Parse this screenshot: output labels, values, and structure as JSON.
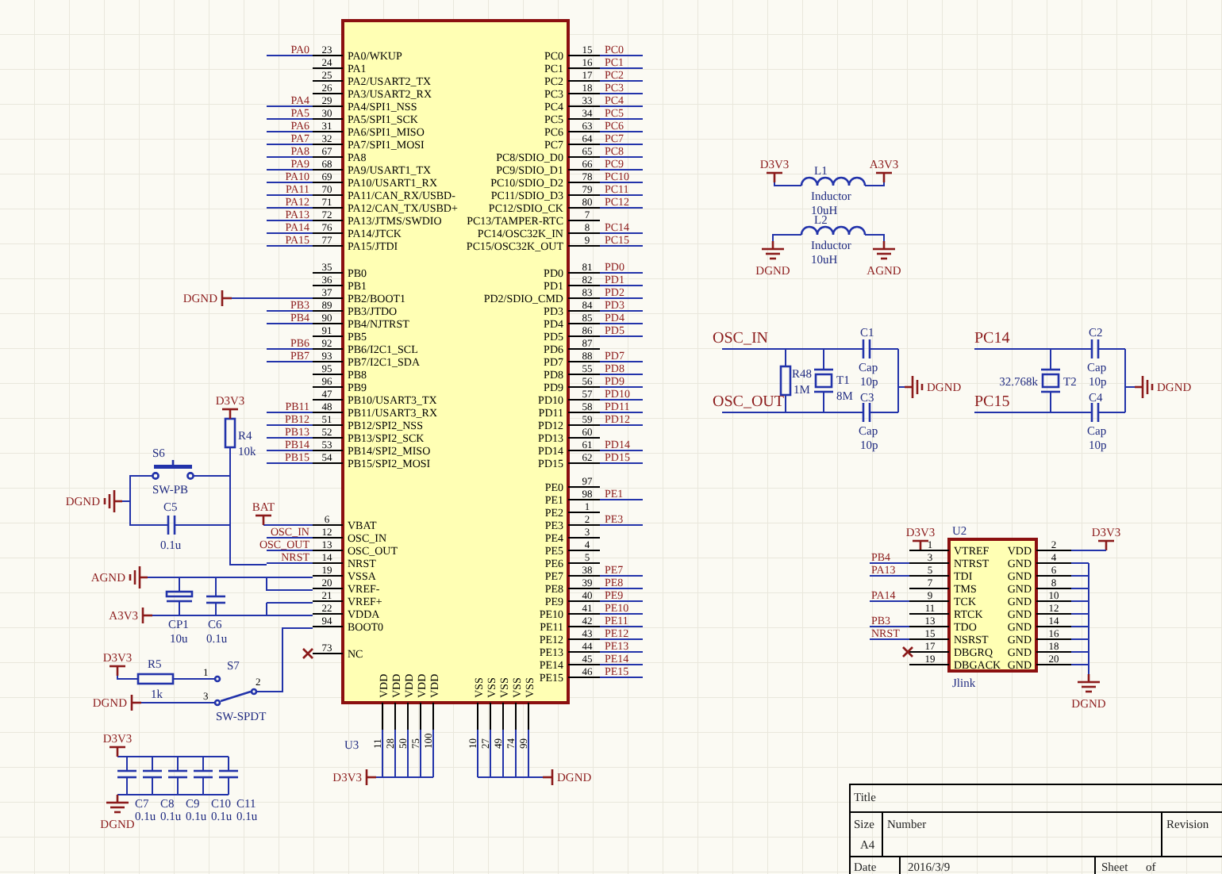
{
  "chip": {
    "designator": "U3",
    "left_pins": [
      {
        "number": "23",
        "name": "PA0/WKUP",
        "net": "PA0",
        "no_connect": false
      },
      {
        "number": "24",
        "name": "PA1",
        "no_connect": false
      },
      {
        "number": "25",
        "name": "PA2/USART2_TX",
        "no_connect": false
      },
      {
        "number": "26",
        "name": "PA3/USART2_RX",
        "no_connect": false
      },
      {
        "number": "29",
        "name": "PA4/SPI1_NSS",
        "net": "PA4",
        "no_connect": false
      },
      {
        "number": "30",
        "name": "PA5/SPI1_SCK",
        "net": "PA5",
        "no_connect": false
      },
      {
        "number": "31",
        "name": "PA6/SPI1_MISO",
        "net": "PA6",
        "no_connect": false
      },
      {
        "number": "32",
        "name": "PA7/SPI1_MOSI",
        "net": "PA7",
        "no_connect": false
      },
      {
        "number": "67",
        "name": "PA8",
        "net": "PA8",
        "no_connect": false
      },
      {
        "number": "68",
        "name": "PA9/USART1_TX",
        "net": "PA9",
        "no_connect": false
      },
      {
        "number": "69",
        "name": "PA10/USART1_RX",
        "net": "PA10",
        "no_connect": false
      },
      {
        "number": "70",
        "name": "PA11/CAN_RX/USBD-",
        "net": "PA11",
        "no_connect": false
      },
      {
        "number": "71",
        "name": "PA12/CAN_TX/USBD+",
        "net": "PA12",
        "no_connect": false
      },
      {
        "number": "72",
        "name": "PA13/JTMS/SWDIO",
        "net": "PA13",
        "no_connect": false
      },
      {
        "number": "76",
        "name": "PA14/JTCK",
        "net": "PA14",
        "no_connect": false
      },
      {
        "number": "77",
        "name": "PA15/JTDI",
        "net": "PA15",
        "no_connect": false
      },
      {
        "number": "35",
        "name": "PB0",
        "no_connect": false
      },
      {
        "number": "36",
        "name": "PB1",
        "no_connect": false
      },
      {
        "number": "37",
        "name": "PB2/BOOT1",
        "no_connect": false
      },
      {
        "number": "89",
        "name": "PB3/JTDO",
        "net": "PB3",
        "no_connect": false
      },
      {
        "number": "90",
        "name": "PB4/NJTRST",
        "net": "PB4",
        "no_connect": false
      },
      {
        "number": "91",
        "name": "PB5",
        "no_connect": false
      },
      {
        "number": "92",
        "name": "PB6/I2C1_SCL",
        "net": "PB6",
        "no_connect": false
      },
      {
        "number": "93",
        "name": "PB7/I2C1_SDA",
        "net": "PB7",
        "no_connect": false
      },
      {
        "number": "95",
        "name": "PB8",
        "no_connect": false
      },
      {
        "number": "96",
        "name": "PB9",
        "no_connect": false
      },
      {
        "number": "47",
        "name": "PB10/USART3_TX",
        "no_connect": false
      },
      {
        "number": "48",
        "name": "PB11/USART3_RX",
        "net": "PB11",
        "no_connect": false
      },
      {
        "number": "51",
        "name": "PB12/SPI2_NSS",
        "net": "PB12",
        "no_connect": false
      },
      {
        "number": "52",
        "name": "PB13/SPI2_SCK",
        "net": "PB13",
        "no_connect": false
      },
      {
        "number": "53",
        "name": "PB14/SPI2_MISO",
        "net": "PB14",
        "no_connect": false
      },
      {
        "number": "54",
        "name": "PB15/SPI2_MOSI",
        "net": "PB15",
        "no_connect": false
      },
      {
        "number": "6",
        "name": "VBAT",
        "no_connect": false
      },
      {
        "number": "12",
        "name": "OSC_IN",
        "net": "OSC_IN",
        "no_connect": false
      },
      {
        "number": "13",
        "name": "OSC_OUT",
        "net": "OSC_OUT",
        "no_connect": false
      },
      {
        "number": "14",
        "name": "NRST",
        "net": "NRST",
        "no_connect": false
      },
      {
        "number": "19",
        "name": "VSSA",
        "no_connect": false
      },
      {
        "number": "20",
        "name": "VREF-",
        "no_connect": false
      },
      {
        "number": "21",
        "name": "VREF+",
        "no_connect": false
      },
      {
        "number": "22",
        "name": "VDDA",
        "no_connect": false
      },
      {
        "number": "94",
        "name": "BOOT0",
        "no_connect": false
      },
      {
        "number": "73",
        "name": "NC",
        "no_connect": true
      }
    ],
    "right_pins": [
      {
        "number": "15",
        "name": "PC0",
        "net": "PC0"
      },
      {
        "number": "16",
        "name": "PC1",
        "net": "PC1"
      },
      {
        "number": "17",
        "name": "PC2",
        "net": "PC2"
      },
      {
        "number": "18",
        "name": "PC3",
        "net": "PC3"
      },
      {
        "number": "33",
        "name": "PC4",
        "net": "PC4"
      },
      {
        "number": "34",
        "name": "PC5",
        "net": "PC5"
      },
      {
        "number": "63",
        "name": "PC6",
        "net": "PC6"
      },
      {
        "number": "64",
        "name": "PC7",
        "net": "PC7"
      },
      {
        "number": "65",
        "name": "PC8/SDIO_D0",
        "net": "PC8"
      },
      {
        "number": "66",
        "name": "PC9/SDIO_D1",
        "net": "PC9"
      },
      {
        "number": "78",
        "name": "PC10/SDIO_D2",
        "net": "PC10"
      },
      {
        "number": "79",
        "name": "PC11/SDIO_D3",
        "net": "PC11"
      },
      {
        "number": "80",
        "name": "PC12/SDIO_CK",
        "net": "PC12"
      },
      {
        "number": "7",
        "name": "PC13/TAMPER-RTC"
      },
      {
        "number": "8",
        "name": "PC14/OSC32K_IN",
        "net": "PC14"
      },
      {
        "number": "9",
        "name": "PC15/OSC32K_OUT",
        "net": "PC15"
      },
      {
        "number": "81",
        "name": "PD0",
        "net": "PD0"
      },
      {
        "number": "82",
        "name": "PD1",
        "net": "PD1"
      },
      {
        "number": "83",
        "name": "PD2/SDIO_CMD",
        "net": "PD2"
      },
      {
        "number": "84",
        "name": "PD3",
        "net": "PD3"
      },
      {
        "number": "85",
        "name": "PD4",
        "net": "PD4"
      },
      {
        "number": "86",
        "name": "PD5",
        "net": "PD5"
      },
      {
        "number": "87",
        "name": "PD6"
      },
      {
        "number": "88",
        "name": "PD7",
        "net": "PD7"
      },
      {
        "number": "55",
        "name": "PD8",
        "net": "PD8"
      },
      {
        "number": "56",
        "name": "PD9",
        "net": "PD9"
      },
      {
        "number": "57",
        "name": "PD10",
        "net": "PD10"
      },
      {
        "number": "58",
        "name": "PD11",
        "net": "PD11"
      },
      {
        "number": "59",
        "name": "PD12",
        "net": "PD12"
      },
      {
        "number": "60",
        "name": "PD13"
      },
      {
        "number": "61",
        "name": "PD14",
        "net": "PD14"
      },
      {
        "number": "62",
        "name": "PD15",
        "net": "PD15"
      },
      {
        "number": "97",
        "name": "PE0"
      },
      {
        "number": "98",
        "name": "PE1",
        "net": "PE1"
      },
      {
        "number": "1",
        "name": "PE2"
      },
      {
        "number": "2",
        "name": "PE3",
        "net": "PE3"
      },
      {
        "number": "3",
        "name": "PE4"
      },
      {
        "number": "4",
        "name": "PE5"
      },
      {
        "number": "5",
        "name": "PE6"
      },
      {
        "number": "38",
        "name": "PE7",
        "net": "PE7"
      },
      {
        "number": "39",
        "name": "PE8",
        "net": "PE8"
      },
      {
        "number": "40",
        "name": "PE9",
        "net": "PE9"
      },
      {
        "number": "41",
        "name": "PE10",
        "net": "PE10"
      },
      {
        "number": "42",
        "name": "PE11",
        "net": "PE11"
      },
      {
        "number": "43",
        "name": "PE12",
        "net": "PE12"
      },
      {
        "number": "44",
        "name": "PE13",
        "net": "PE13"
      },
      {
        "number": "45",
        "name": "PE14",
        "net": "PE14"
      },
      {
        "number": "46",
        "name": "PE15",
        "net": "PE15"
      }
    ],
    "bottom_pins": [
      {
        "number": "11",
        "name": "VDD"
      },
      {
        "number": "28",
        "name": "VDD"
      },
      {
        "number": "50",
        "name": "VDD"
      },
      {
        "number": "75",
        "name": "VDD"
      },
      {
        "number": "100",
        "name": "VDD"
      },
      {
        "number": "10",
        "name": "VSS"
      },
      {
        "number": "27",
        "name": "VSS"
      },
      {
        "number": "49",
        "name": "VSS"
      },
      {
        "number": "74",
        "name": "VSS"
      },
      {
        "number": "99",
        "name": "VSS"
      }
    ]
  },
  "components": [
    {
      "kind": "inductor",
      "designator": "L1",
      "comment": "Inductor",
      "value": "10uH"
    },
    {
      "kind": "inductor",
      "designator": "L2",
      "comment": "Inductor",
      "value": "10uH"
    },
    {
      "kind": "resistor",
      "designator": "R48",
      "value": "1M"
    },
    {
      "kind": "crystal",
      "designator": "T1",
      "value": "8M"
    },
    {
      "kind": "capacitor",
      "designator": "C1",
      "comment": "Cap",
      "value": "10p"
    },
    {
      "kind": "crystal",
      "designator": "T2",
      "value": "32.768k"
    },
    {
      "kind": "capacitor",
      "designator": "C2",
      "comment": "Cap",
      "value": "10p"
    },
    {
      "kind": "resistor",
      "designator": "R4",
      "value": "10k"
    },
    {
      "kind": "capacitor",
      "designator": "C3",
      "comment": "Cap",
      "value": "10p"
    },
    {
      "kind": "capacitor",
      "designator": "C4",
      "comment": "Cap",
      "value": "10p"
    },
    {
      "kind": "push_button",
      "designator": "S6",
      "value": "SW-PB"
    },
    {
      "kind": "capacitor",
      "designator": "C5",
      "value": "0.1u"
    },
    {
      "kind": "polarized_capacitor",
      "designator": "CP1",
      "value": "10u"
    },
    {
      "kind": "capacitor",
      "designator": "C6",
      "value": "0.1u"
    },
    {
      "kind": "resistor",
      "designator": "R5",
      "value": "1k"
    },
    {
      "kind": "spdt_switch",
      "designator": "S7",
      "value": "SW-SPDT",
      "pins": [
        "1",
        "3",
        "2"
      ]
    },
    {
      "kind": "capacitor",
      "designator": "C7",
      "value": "0.1u"
    },
    {
      "kind": "capacitor",
      "designator": "C8",
      "value": "0.1u"
    },
    {
      "kind": "capacitor",
      "designator": "C9",
      "value": "0.1u"
    },
    {
      "kind": "capacitor",
      "designator": "C10",
      "value": "0.1u"
    },
    {
      "kind": "capacitor",
      "designator": "C11",
      "value": "0.1u"
    }
  ],
  "power_ports": [
    {
      "name": "D3V3",
      "kind": "bar"
    },
    {
      "name": "A3V3",
      "kind": "bar"
    },
    {
      "name": "DGND",
      "kind": "ground"
    },
    {
      "name": "AGND",
      "kind": "ground"
    },
    {
      "name": "DGND",
      "kind": "bar"
    },
    {
      "name": "DGND",
      "kind": "ground"
    },
    {
      "name": "DGND",
      "kind": "ground"
    },
    {
      "name": "D3V3",
      "kind": "bar"
    },
    {
      "name": "DGND",
      "kind": "ground"
    },
    {
      "name": "BAT",
      "kind": "bar"
    },
    {
      "name": "AGND",
      "kind": "ground"
    },
    {
      "name": "A3V3",
      "kind": "bar"
    },
    {
      "name": "D3V3",
      "kind": "bar"
    },
    {
      "name": "D3V3",
      "kind": "bar"
    },
    {
      "name": "D3V3",
      "kind": "bar"
    },
    {
      "name": "DGND",
      "kind": "bar"
    },
    {
      "name": "DGND",
      "kind": "ground"
    },
    {
      "name": "D3V3",
      "kind": "bar"
    },
    {
      "name": "D3V3",
      "kind": "bar"
    },
    {
      "name": "DGND",
      "kind": "bar"
    },
    {
      "name": "DGND",
      "kind": "ground"
    }
  ],
  "net_labels": [
    "OSC_IN",
    "OSC_OUT",
    "PC14",
    "PC15"
  ],
  "jlink": {
    "designator": "U2",
    "comment": "Jlink",
    "rows": [
      {
        "left_number": "1",
        "left_name": "VTREF",
        "right_name": "VDD",
        "right_number": "2",
        "no_connect": false
      },
      {
        "left_number": "3",
        "left_name": "NTRST",
        "right_name": "GND",
        "right_number": "4",
        "net": "PB4",
        "no_connect": false
      },
      {
        "left_number": "5",
        "left_name": "TDI",
        "right_name": "GND",
        "right_number": "6",
        "net": "PA13",
        "no_connect": false
      },
      {
        "left_number": "7",
        "left_name": "TMS",
        "right_name": "GND",
        "right_number": "8",
        "no_connect": false
      },
      {
        "left_number": "9",
        "left_name": "TCK",
        "right_name": "GND",
        "right_number": "10",
        "net": "PA14",
        "no_connect": false
      },
      {
        "left_number": "11",
        "left_name": "RTCK",
        "right_name": "GND",
        "right_number": "12",
        "no_connect": false
      },
      {
        "left_number": "13",
        "left_name": "TDO",
        "right_name": "GND",
        "right_number": "14",
        "net": "PB3",
        "no_connect": false
      },
      {
        "left_number": "15",
        "left_name": "NSRST",
        "right_name": "GND",
        "right_number": "16",
        "net": "NRST",
        "no_connect": false
      },
      {
        "left_number": "17",
        "left_name": "DBGRQ",
        "right_name": "GND",
        "right_number": "18",
        "no_connect": true
      },
      {
        "left_number": "19",
        "left_name": "DBGACK",
        "right_name": "GND",
        "right_number": "20",
        "no_connect": false
      }
    ]
  },
  "title_block": {
    "title_label": "Title",
    "size_label": "Size",
    "size": "A4",
    "number_label": "Number",
    "revision_label": "Revision",
    "date_label": "Date",
    "date": "2016/3/9",
    "sheet_label": "Sheet",
    "of_label": "of"
  }
}
